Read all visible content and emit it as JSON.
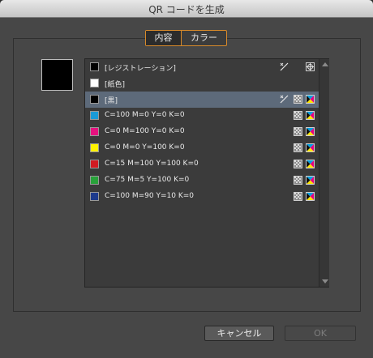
{
  "window": {
    "title": "QR コードを生成"
  },
  "tabs": [
    {
      "label": "内容",
      "active": true
    },
    {
      "label": "カラー",
      "active": false
    }
  ],
  "preview": {
    "color": "#000000"
  },
  "swatches": [
    {
      "label": "[レジストレーション]",
      "color": "#000000",
      "icons": [
        "no-edit-icon",
        "registration-icon"
      ],
      "selected": false
    },
    {
      "label": "[紙色]",
      "color": "#ffffff",
      "icons": [],
      "selected": false
    },
    {
      "label": "[黒]",
      "color": "#000000",
      "icons": [
        "no-edit-icon",
        "process-color-icon",
        "cmyk-icon"
      ],
      "selected": true
    },
    {
      "label": "C=100 M=0 Y=0 K=0",
      "color": "#1a9ad8",
      "icons": [
        "process-color-icon",
        "cmyk-icon"
      ],
      "selected": false
    },
    {
      "label": "C=0 M=100 Y=0 K=0",
      "color": "#e6117f",
      "icons": [
        "process-color-icon",
        "cmyk-icon"
      ],
      "selected": false
    },
    {
      "label": "C=0 M=0 Y=100 K=0",
      "color": "#fff200",
      "icons": [
        "process-color-icon",
        "cmyk-icon"
      ],
      "selected": false
    },
    {
      "label": "C=15 M=100 Y=100 K=0",
      "color": "#d11a22",
      "icons": [
        "process-color-icon",
        "cmyk-icon"
      ],
      "selected": false
    },
    {
      "label": "C=75 M=5 Y=100 K=0",
      "color": "#28a23a",
      "icons": [
        "process-color-icon",
        "cmyk-icon"
      ],
      "selected": false
    },
    {
      "label": "C=100 M=90 Y=10 K=0",
      "color": "#1d3a8c",
      "icons": [
        "process-color-icon",
        "cmyk-icon"
      ],
      "selected": false
    }
  ],
  "buttons": {
    "cancel": "キャンセル",
    "ok": "OK"
  }
}
